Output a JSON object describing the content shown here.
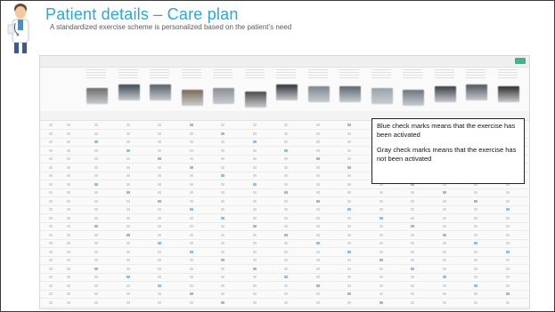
{
  "slide": {
    "title": "Patient details – Care plan",
    "subtitle": "A standardized exercise scheme is personalized based on the patient’s need"
  },
  "callout": {
    "blue_text": "Blue check marks means that the exercise has been activated",
    "gray_text": "Gray check marks means that the exercise has not been activated"
  },
  "colors": {
    "title": "#2aa8d8",
    "activated_check": "#3b8fd9",
    "inactive_check": "#b5b5b5",
    "save_button": "#3fb58f"
  },
  "icons": {
    "mascot": "doctor-mascot-icon"
  }
}
